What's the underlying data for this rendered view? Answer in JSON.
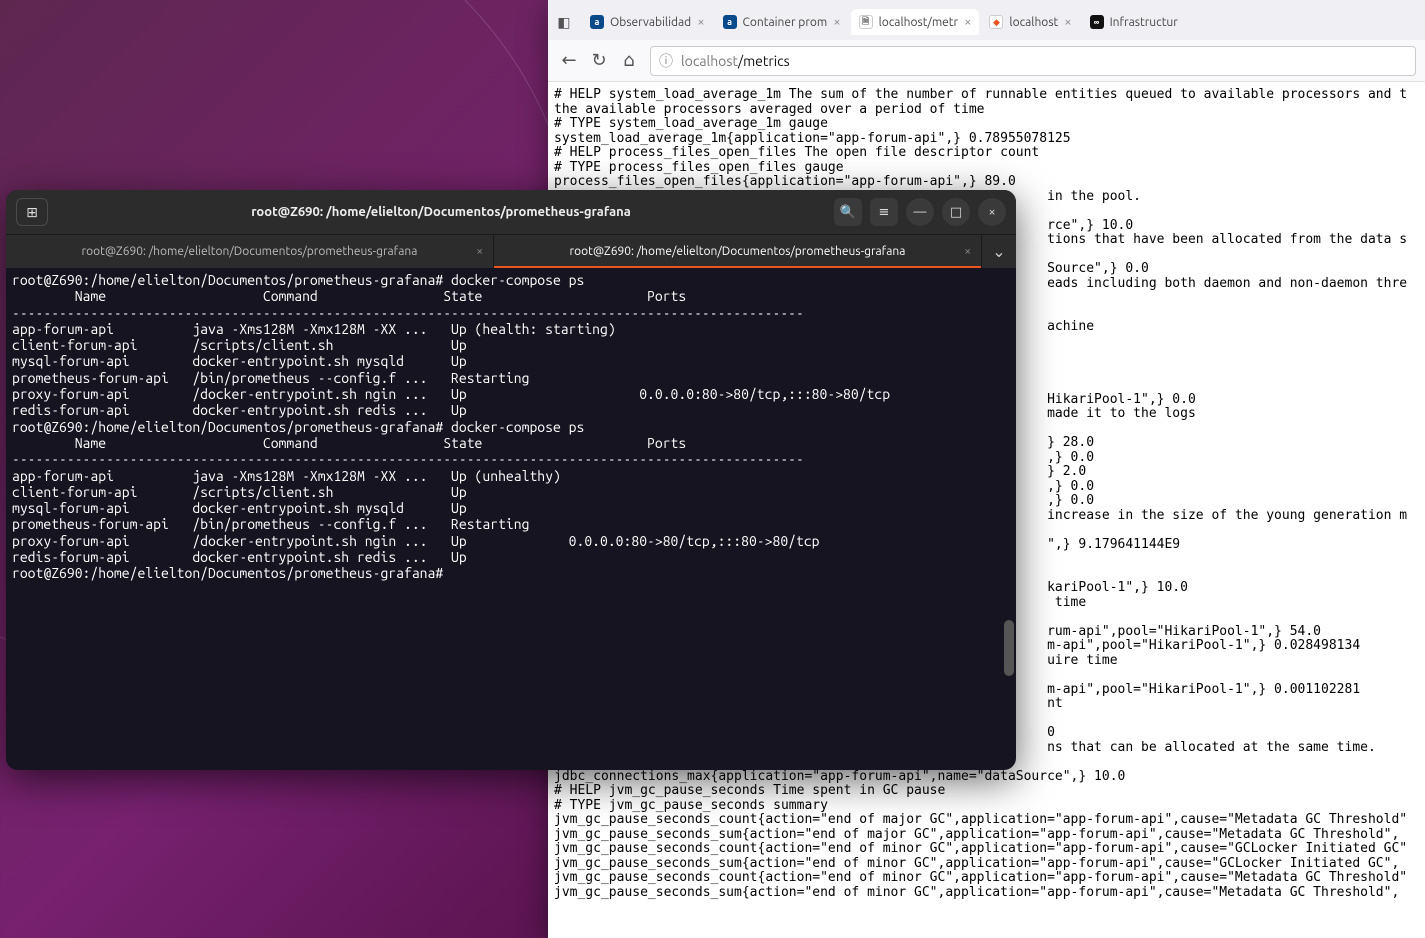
{
  "browser": {
    "tabs": [
      {
        "label": "Observabilidad",
        "favicon_bg": "#0a4a8a",
        "favicon_text": "a"
      },
      {
        "label": "Container prom",
        "favicon_bg": "#0a4a8a",
        "favicon_text": "a"
      },
      {
        "label": "localhost/metr",
        "favicon_bg": "#fff",
        "favicon_text": "",
        "active": true
      },
      {
        "label": "localhost",
        "favicon_bg": "#fff",
        "favicon_text": ""
      },
      {
        "label": "Infrastructur",
        "favicon_bg": "#111",
        "favicon_text": "∞"
      }
    ],
    "url_host": "localhost",
    "url_path": "/metrics",
    "content": "# HELP system_load_average_1m The sum of the number of runnable entities queued to available processors and t\nthe available processors averaged over a period of time\n# TYPE system_load_average_1m gauge\nsystem_load_average_1m{application=\"app-forum-api\",} 0.78955078125\n# HELP process_files_open_files The open file descriptor count\n# TYPE process_files_open_files gauge\nprocess_files_open_files{application=\"app-forum-api\",} 89.0\n                                                               in the pool.\n\n                                                               rce\",} 10.0\n                                                               tions that have been allocated from the data s\n\n                                                               Source\",} 0.0\n                                                               eads including both daemon and non-daemon thre\n\n\n                                                               achine\n\n\n\n\n                                                               HikariPool-1\",} 0.0\n                                                               made it to the logs\n\n                                                               } 28.0\n                                                               ,} 0.0\n                                                               } 2.0\n                                                               ,} 0.0\n                                                               ,} 0.0\n                                                               increase in the size of the young generation m\n\n                                                               \",} 9.179641144E9\n\n\n                                                               kariPool-1\",} 10.0\n                                                                time\n\n                                                               rum-api\",pool=\"HikariPool-1\",} 54.0\n                                                               m-api\",pool=\"HikariPool-1\",} 0.028498134\n                                                               uire time\n\n                                                               m-api\",pool=\"HikariPool-1\",} 0.001102281\n                                                               nt\n\n                                                               0\n                                                               ns that can be allocated at the same time.\n\njdbc_connections_max{application=\"app-forum-api\",name=\"dataSource\",} 10.0\n# HELP jvm_gc_pause_seconds Time spent in GC pause\n# TYPE jvm_gc_pause_seconds summary\njvm_gc_pause_seconds_count{action=\"end of major GC\",application=\"app-forum-api\",cause=\"Metadata GC Threshold\"\njvm_gc_pause_seconds_sum{action=\"end of major GC\",application=\"app-forum-api\",cause=\"Metadata GC Threshold\",\njvm_gc_pause_seconds_count{action=\"end of minor GC\",application=\"app-forum-api\",cause=\"GCLocker Initiated GC\"\njvm_gc_pause_seconds_sum{action=\"end of minor GC\",application=\"app-forum-api\",cause=\"GCLocker Initiated GC\",\njvm_gc_pause_seconds_count{action=\"end of minor GC\",application=\"app-forum-api\",cause=\"Metadata GC Threshold\"\njvm_gc_pause_seconds_sum{action=\"end of minor GC\",application=\"app-forum-api\",cause=\"Metadata GC Threshold\","
  },
  "terminal": {
    "title": "root@Z690: /home/elielton/Documentos/prometheus-grafana",
    "tabs": [
      "root@Z690: /home/elielton/Documentos/prometheus-grafana",
      "root@Z690: /home/elielton/Documentos/prometheus-grafana"
    ],
    "body": "root@Z690:/home/elielton/Documentos/prometheus-grafana# docker-compose ps\n        Name                    Command                State                     Ports              \n-----------------------------------------------------------------------------------------------------\napp-forum-api          java -Xms128M -Xmx128M -XX ...   Up (health: starting)                        \nclient-forum-api       /scripts/client.sh               Up                                           \nmysql-forum-api        docker-entrypoint.sh mysqld      Up                                           \nprometheus-forum-api   /bin/prometheus --config.f ...   Restarting                                   \nproxy-forum-api        /docker-entrypoint.sh ngin ...   Up                      0.0.0.0:80->80/tcp,:::80->80/tcp\nredis-forum-api        docker-entrypoint.sh redis ...   Up                                           \nroot@Z690:/home/elielton/Documentos/prometheus-grafana# docker-compose ps\n        Name                    Command                State                     Ports              \n-----------------------------------------------------------------------------------------------------\napp-forum-api          java -Xms128M -Xmx128M -XX ...   Up (unhealthy)                               \nclient-forum-api       /scripts/client.sh               Up                                           \nmysql-forum-api        docker-entrypoint.sh mysqld      Up                                           \nprometheus-forum-api   /bin/prometheus --config.f ...   Restarting                                   \nproxy-forum-api        /docker-entrypoint.sh ngin ...   Up             0.0.0.0:80->80/tcp,:::80->80/tcp\nredis-forum-api        docker-entrypoint.sh redis ...   Up                                           \nroot@Z690:/home/elielton/Documentos/prometheus-grafana# "
  }
}
